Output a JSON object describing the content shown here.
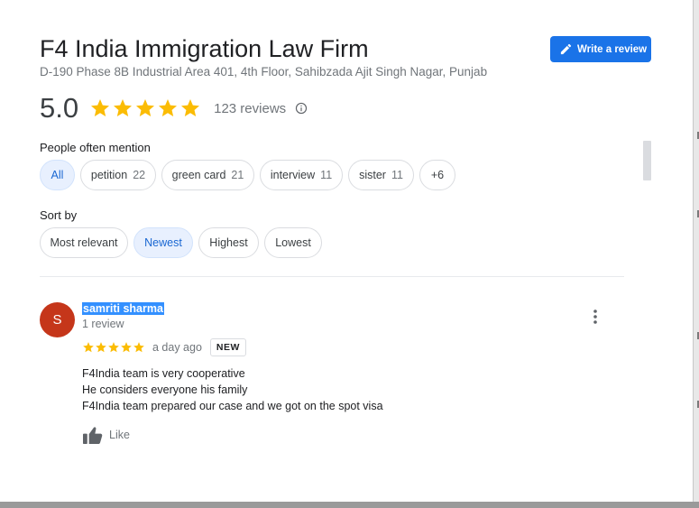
{
  "business": {
    "name": "F4 India Immigration Law Firm",
    "address": "D-190 Phase 8B Industrial Area 401, 4th Floor, Sahibzada Ajit Singh Nagar, Punjab",
    "rating": "5.0",
    "star_count": 5,
    "reviews_label": "123 reviews"
  },
  "actions": {
    "write_review_label": "Write a review"
  },
  "mentions": {
    "label": "People often mention",
    "chips": [
      {
        "label": "All",
        "count": "",
        "selected": true
      },
      {
        "label": "petition",
        "count": "22",
        "selected": false
      },
      {
        "label": "green card",
        "count": "21",
        "selected": false
      },
      {
        "label": "interview",
        "count": "11",
        "selected": false
      },
      {
        "label": "sister",
        "count": "11",
        "selected": false
      },
      {
        "label": "+6",
        "count": "",
        "selected": false
      }
    ]
  },
  "sort": {
    "label": "Sort by",
    "options": [
      {
        "label": "Most relevant",
        "selected": false
      },
      {
        "label": "Newest",
        "selected": true
      },
      {
        "label": "Highest",
        "selected": false
      },
      {
        "label": "Lowest",
        "selected": false
      }
    ]
  },
  "review": {
    "avatar_letter": "S",
    "avatar_color": "#c5361a",
    "reviewer_name": "samriti sharma",
    "reviewer_review_count": "1 review",
    "stars": 5,
    "date": "a day ago",
    "badge": "NEW",
    "lines": [
      "F4India team is very cooperative",
      "He considers everyone his family",
      "F4India team prepared our case and we got on the spot visa"
    ],
    "like_label": "Like"
  },
  "icons": {
    "write": "pencil-icon",
    "info": "info-icon",
    "more": "more-vert-icon",
    "like": "thumbs-up-icon",
    "star": "star-icon"
  },
  "colors": {
    "accent": "#1a73e8",
    "star": "#fbbc04",
    "selected_chip_bg": "#e8f0fe",
    "selected_chip_text": "#1967d2"
  }
}
